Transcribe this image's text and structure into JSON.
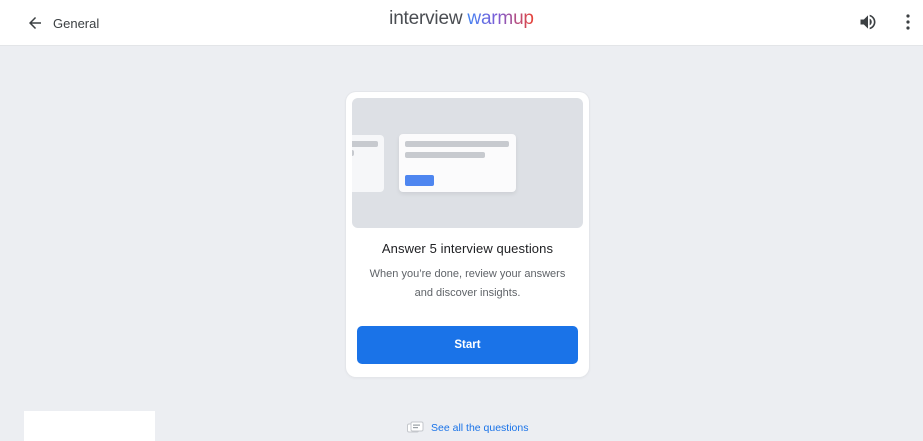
{
  "header": {
    "back_label": "General",
    "back_icon": "arrow-left-icon",
    "logo_part1": "interview ",
    "logo_part2": "warmup",
    "volume_icon": "volume-icon",
    "more_icon": "more-vertical-icon"
  },
  "card": {
    "title": "Answer 5 interview questions",
    "description": "When you’re done, review your answers and discover insights.",
    "start_label": "Start"
  },
  "footer": {
    "see_all_label": "See all the questions",
    "see_all_icon": "question-list-icon"
  },
  "colors": {
    "accent": "#1a73e8",
    "background": "#eceef2",
    "header_bg": "#ffffff",
    "illustration_bg": "#dde0e5"
  }
}
